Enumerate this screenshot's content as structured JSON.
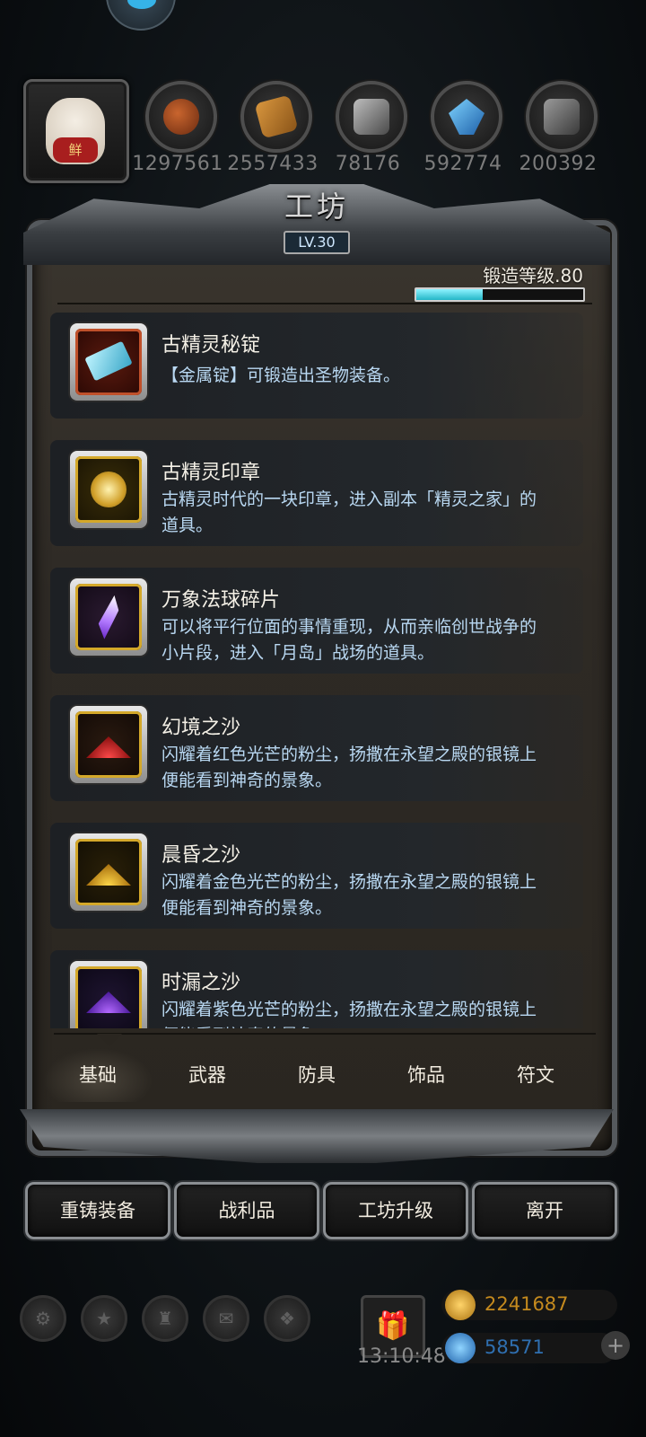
{
  "resources": {
    "values": [
      "1297561",
      "2557433",
      "78176",
      "592774",
      "200392"
    ],
    "icons": [
      "meat-icon",
      "wood-icon",
      "iron-icon",
      "crystal-icon",
      "stone-icon"
    ],
    "avatar_badge": "鲜"
  },
  "panel": {
    "title": "工坊",
    "level": "LV.30",
    "forge_label": "锻造等级.80",
    "forge_progress": 0.4
  },
  "items": [
    {
      "name": "古精灵秘锭",
      "desc": "【金属锭】可锻造出圣物装备。",
      "frame": "red",
      "icon": "ingot-icon"
    },
    {
      "name": "古精灵印章",
      "desc": "古精灵时代的一块印章，进入副本「精灵之家」的道具。",
      "frame": "gold",
      "icon": "seal-icon"
    },
    {
      "name": "万象法球碎片",
      "desc": "可以将平行位面的事情重现，从而亲临创世战争的小片段，进入「月岛」战场的道具。",
      "frame": "gold",
      "icon": "crystal-shard-icon"
    },
    {
      "name": "幻境之沙",
      "desc": "闪耀着红色光芒的粉尘，扬撒在永望之殿的银镜上便能看到神奇的景象。",
      "frame": "gold",
      "icon": "red-sand-icon"
    },
    {
      "name": "晨昏之沙",
      "desc": "闪耀着金色光芒的粉尘，扬撒在永望之殿的银镜上便能看到神奇的景象。",
      "frame": "gold",
      "icon": "gold-sand-icon"
    },
    {
      "name": "时漏之沙",
      "desc": "闪耀着紫色光芒的粉尘，扬撒在永望之殿的银镜上便能看到神奇的景象。",
      "frame": "gold",
      "icon": "purple-sand-icon"
    }
  ],
  "tabs": [
    "基础",
    "武器",
    "防具",
    "饰品",
    "符文"
  ],
  "active_tab": "基础",
  "actions": [
    "重铸装备",
    "战利品",
    "工坊升级",
    "离开"
  ],
  "footer": {
    "time": "13:10:48",
    "gold": "2241687",
    "gems": "58571",
    "plus": "+"
  },
  "colors": {
    "gold": "#c58a1e",
    "gem": "#2f6fb0",
    "desc": "#b9d8f2",
    "bar": "#23b6c8"
  }
}
